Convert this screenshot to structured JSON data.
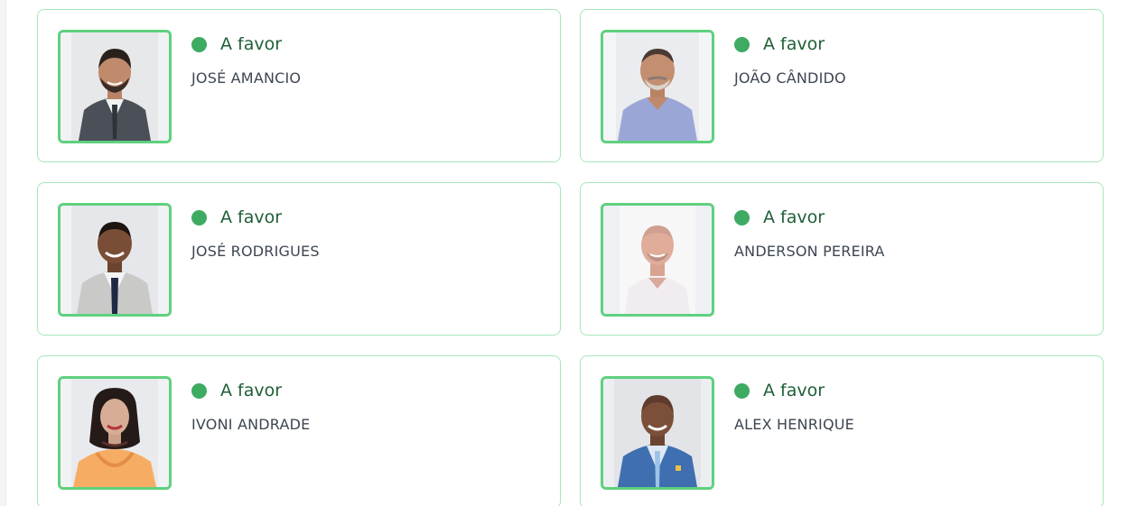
{
  "theme": {
    "card_border": "#a6e6b8",
    "photo_border": "#5fd07f",
    "status_dot": "#3eab62",
    "status_text": "#1f5f36",
    "name_text": "#3d4652"
  },
  "councillors": [
    {
      "name": "JOSÉ AMANCIO",
      "vote": "A favor",
      "status_icon": "green-dot"
    },
    {
      "name": "JOÃO CÂNDIDO",
      "vote": "A favor",
      "status_icon": "green-dot"
    },
    {
      "name": "JOSÉ RODRIGUES",
      "vote": "A favor",
      "status_icon": "green-dot"
    },
    {
      "name": "ANDERSON PEREIRA",
      "vote": "A favor",
      "status_icon": "green-dot"
    },
    {
      "name": "IVONI ANDRADE",
      "vote": "A favor",
      "status_icon": "green-dot"
    },
    {
      "name": "ALEX HENRIQUE",
      "vote": "A favor",
      "status_icon": "green-dot"
    }
  ]
}
